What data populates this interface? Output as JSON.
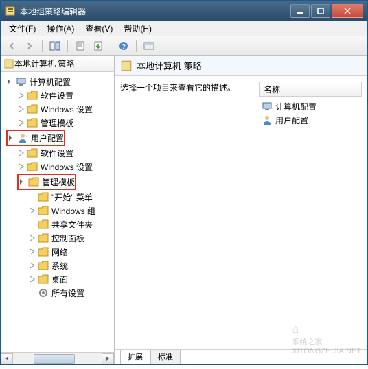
{
  "window": {
    "title": "本地组策略编辑器"
  },
  "menu": {
    "file": "文件(F)",
    "action": "操作(A)",
    "view": "查看(V)",
    "help": "帮助(H)"
  },
  "tree": {
    "root": "本地计算机 策略",
    "computer_config": "计算机配置",
    "software_settings": "软件设置",
    "windows_settings": "Windows 设置",
    "admin_templates": "管理模板",
    "user_config": "用户配置",
    "software_settings2": "软件设置",
    "windows_settings2": "Windows 设置",
    "admin_templates2": "管理模板",
    "start_menu": "\"开始\" 菜单",
    "windows_components": "Windows 组",
    "shared_folders": "共享文件夹",
    "control_panel": "控制面板",
    "network": "网络",
    "system": "系统",
    "desktop": "桌面",
    "all_settings": "所有设置"
  },
  "detail": {
    "header": "本地计算机 策略",
    "description": "选择一个项目来查看它的描述。",
    "column_name": "名称",
    "item_computer": "计算机配置",
    "item_user": "用户配置"
  },
  "tabs": {
    "extended": "扩展",
    "standard": "标准"
  },
  "watermark": {
    "site": "系统之家",
    "url": "XITONGZHIJIA.NET"
  }
}
